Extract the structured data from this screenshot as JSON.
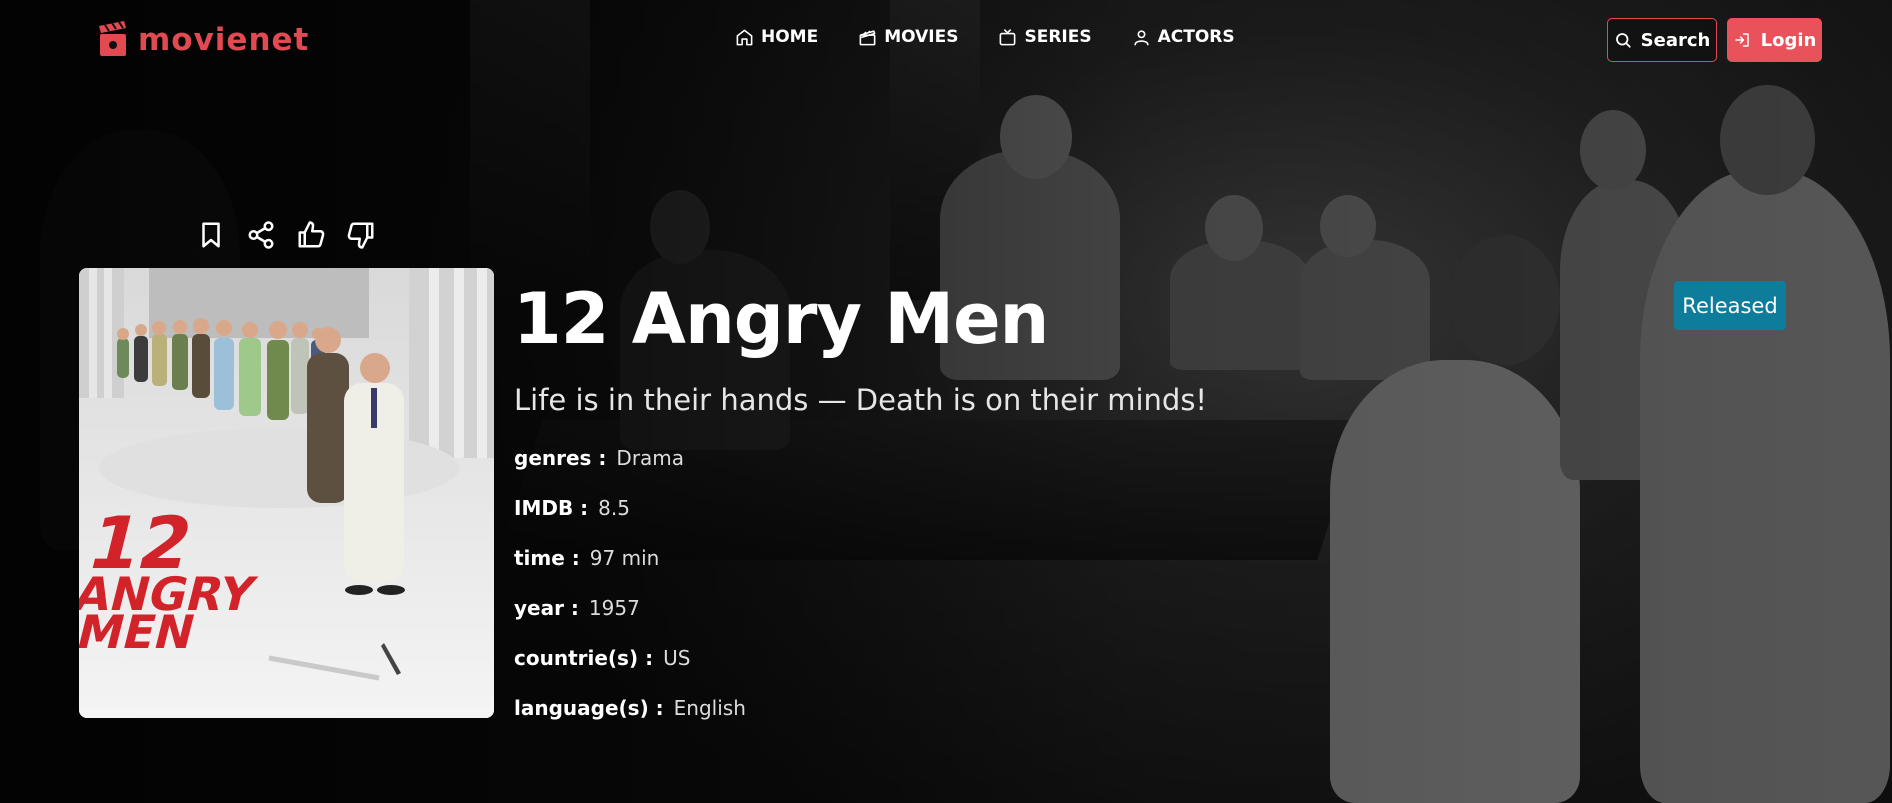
{
  "brand": {
    "name": "movienet",
    "accent_color": "#e24a52"
  },
  "nav": {
    "items": [
      {
        "label": "HOME",
        "icon": "home-icon"
      },
      {
        "label": "MOVIES",
        "icon": "clapperboard-icon"
      },
      {
        "label": "SERIES",
        "icon": "tv-icon"
      },
      {
        "label": "ACTORS",
        "icon": "user-icon"
      }
    ]
  },
  "header": {
    "search_label": "Search",
    "login_label": "Login",
    "login_color": "#e9525a"
  },
  "actions": [
    {
      "name": "bookmark",
      "icon": "bookmark-icon"
    },
    {
      "name": "share",
      "icon": "share-icon"
    },
    {
      "name": "like",
      "icon": "thumbs-up-icon"
    },
    {
      "name": "dislike",
      "icon": "thumbs-down-icon"
    }
  ],
  "movie": {
    "title": "12 Angry Men",
    "tagline": "Life is in their hands — Death is on their minds!",
    "status": "Released",
    "status_color": "#0e7c9b",
    "poster": {
      "title_line1": "12",
      "title_line2": "ANGRY",
      "title_line3": "MEN"
    },
    "details": [
      {
        "label": "genres :",
        "value": "Drama"
      },
      {
        "label": "IMDB :",
        "value": "8.5"
      },
      {
        "label": "time :",
        "value": "97 min"
      },
      {
        "label": "year :",
        "value": "1957"
      },
      {
        "label": "countrie(s) :",
        "value": "US"
      },
      {
        "label": "language(s) :",
        "value": "English"
      }
    ]
  }
}
